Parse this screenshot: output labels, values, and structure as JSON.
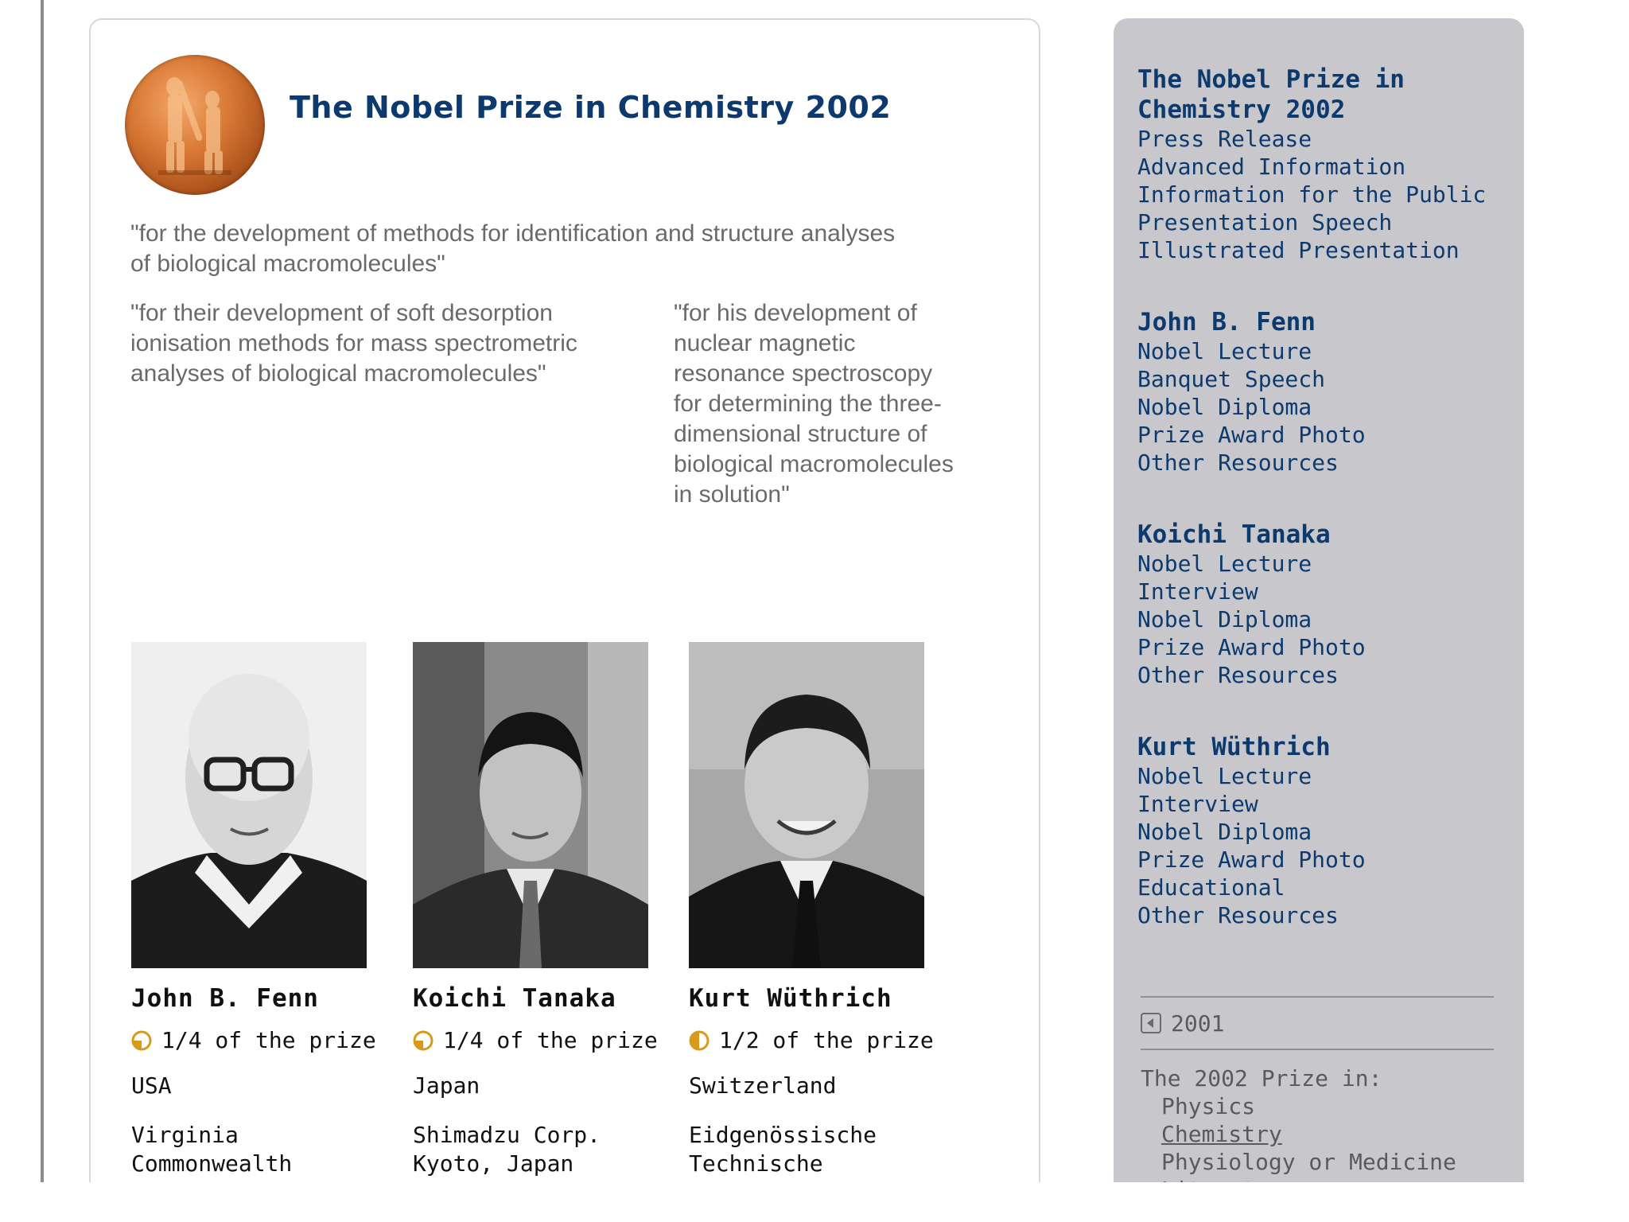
{
  "prize": {
    "title": "The Nobel Prize in Chemistry 2002",
    "motivation_main": "\"for the development of methods for identification and structure analyses of biological macromolecules\"",
    "motivation_left": "\"for their development of soft desorption ionisation methods for mass spectrometric analyses of biological macromolecules\"",
    "motivation_right": "\"for his development of nuclear magnetic resonance spectroscopy for determining the three-dimensional structure of biological macromolecules in solution\""
  },
  "laureates": [
    {
      "name": "John B. Fenn",
      "share": "1/4 of the prize",
      "share_fraction": 0.25,
      "country": "USA",
      "affiliation": "Virginia\nCommonwealth\nUniversity"
    },
    {
      "name": "Koichi Tanaka",
      "share": "1/4 of the prize",
      "share_fraction": 0.25,
      "country": "Japan",
      "affiliation": "Shimadzu Corp.\nKyoto, Japan"
    },
    {
      "name": "Kurt Wüthrich",
      "share": "1/2 of the prize",
      "share_fraction": 0.5,
      "country": "Switzerland",
      "affiliation": "Eidgenössische\nTechnische\nHochschule (Swiss"
    }
  ],
  "sidebar": {
    "prize_title": "The Nobel Prize in Chemistry 2002",
    "prize_links": [
      "Press Release",
      "Advanced Information",
      "Information for the Public",
      "Presentation Speech",
      "Illustrated Presentation"
    ],
    "groups": [
      {
        "name": "John B. Fenn",
        "links": [
          "Nobel Lecture",
          "Banquet Speech",
          "Nobel Diploma",
          "Prize Award Photo",
          "Other Resources"
        ]
      },
      {
        "name": "Koichi Tanaka",
        "links": [
          "Nobel Lecture",
          "Interview",
          "Nobel Diploma",
          "Prize Award Photo",
          "Other Resources"
        ]
      },
      {
        "name": "Kurt Wüthrich",
        "links": [
          "Nobel Lecture",
          "Interview",
          "Nobel Diploma",
          "Prize Award Photo",
          "Educational",
          "Other Resources"
        ]
      }
    ],
    "previous_year": "2001",
    "prizes_title": "The 2002 Prize in:",
    "prizes": [
      "Physics",
      "Chemistry",
      "Physiology or Medicine",
      "Literature"
    ],
    "current_prize": "Chemistry"
  },
  "colors": {
    "title_blue": "#0d3a6e",
    "share_icon": "#d89a1a",
    "sidebar_bg": "#c8c8cc"
  },
  "icons": {
    "medal": "nobel-medal-image",
    "share": "prize-share-pie-icon",
    "previous": "previous-arrow-icon"
  }
}
